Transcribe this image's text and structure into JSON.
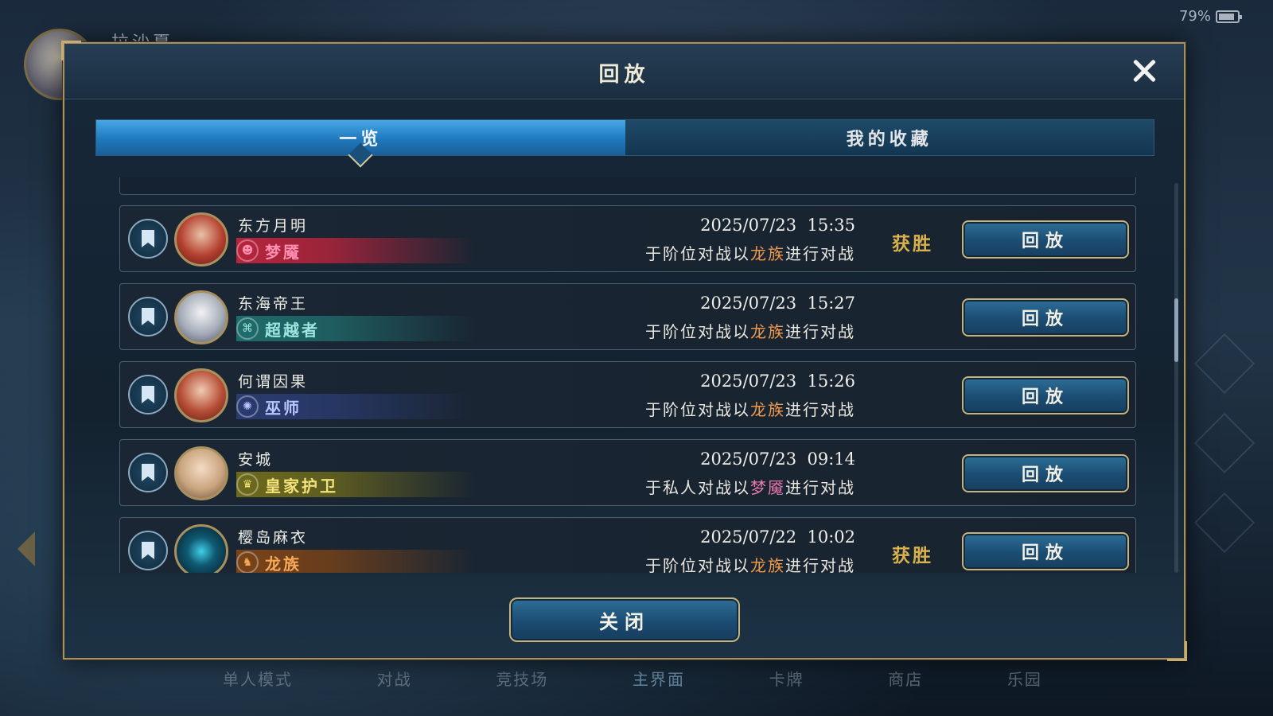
{
  "status_bar": {
    "battery_text": "79%",
    "battery_level": 0.79
  },
  "background": {
    "player_name": "拉沙夏",
    "bottom_nav": [
      "单人模式",
      "对战",
      "竞技场",
      "主界面",
      "卡牌",
      "商店",
      "乐园"
    ],
    "bottom_nav_selected": "主界面"
  },
  "modal": {
    "title": "回放",
    "tabs": [
      {
        "label": "一览",
        "active": true
      },
      {
        "label": "我的收藏",
        "active": false
      }
    ],
    "replay_label": "回放",
    "close_label": "关闭",
    "records": [
      {
        "name": "东方月明",
        "class_name": "梦魇",
        "class_color": "#b8243c",
        "class_text": "#ff8fb0",
        "icon": "nightmare-icon",
        "datetime": "2025/07/23  15:35",
        "desc_pre": "于阶位对战以",
        "desc_hl": "龙族",
        "desc_post": "进行对战",
        "result": "获胜"
      },
      {
        "name": "东海帝王",
        "class_name": "超越者",
        "class_color": "#1f6b6b",
        "class_text": "#9ee6e0",
        "icon": "transcendent-icon",
        "datetime": "2025/07/23  15:27",
        "desc_pre": "于阶位对战以",
        "desc_hl": "龙族",
        "desc_post": "进行对战",
        "result": ""
      },
      {
        "name": "何谓因果",
        "class_name": "巫师",
        "class_color": "#2a3b70",
        "class_text": "#b7c6ff",
        "icon": "witch-icon",
        "datetime": "2025/07/23  15:26",
        "desc_pre": "于阶位对战以",
        "desc_hl": "龙族",
        "desc_post": "进行对战",
        "result": ""
      },
      {
        "name": "安城",
        "class_name": "皇家护卫",
        "class_color": "#6e6a1c",
        "class_text": "#f2e27a",
        "icon": "royal-crown-icon",
        "datetime": "2025/07/23  09:14",
        "desc_pre": "于私人对战以",
        "desc_hl": "梦魇",
        "desc_post": "进行对战",
        "result": ""
      },
      {
        "name": "樱岛麻衣",
        "class_name": "龙族",
        "class_color": "#7a4318",
        "class_text": "#f5a858",
        "icon": "dragon-icon",
        "datetime": "2025/07/22  10:02",
        "desc_pre": "于阶位对战以",
        "desc_hl": "龙族",
        "desc_post": "进行对战",
        "result": "获胜"
      }
    ]
  }
}
